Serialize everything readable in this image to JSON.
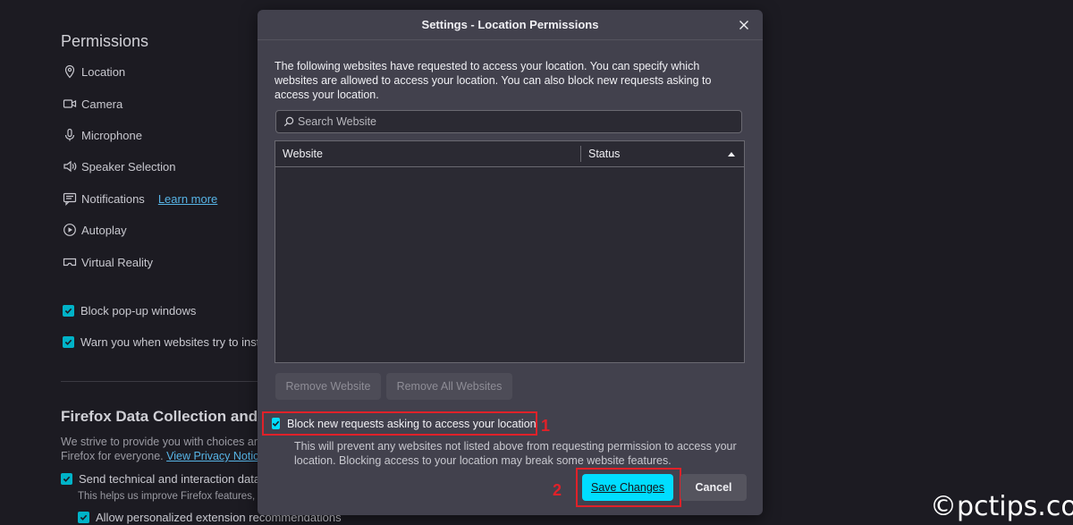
{
  "background": {
    "permissions_title": "Permissions",
    "permissions": [
      {
        "label": "Location",
        "icon": "location-pin-icon"
      },
      {
        "label": "Camera",
        "icon": "camera-icon"
      },
      {
        "label": "Microphone",
        "icon": "microphone-icon"
      },
      {
        "label": "Speaker Selection",
        "icon": "speaker-icon"
      },
      {
        "label": "Notifications",
        "icon": "notification-icon",
        "link": "Learn more"
      },
      {
        "label": "Autoplay",
        "icon": "autoplay-icon"
      },
      {
        "label": "Virtual Reality",
        "icon": "vr-icon"
      }
    ],
    "block_popups": "Block pop-up windows",
    "warn_addons": "Warn you when websites try to instal",
    "data_collection_title": "Firefox Data Collection and",
    "data_desc_1": "We strive to provide you with choices and",
    "data_desc_2_prefix": "Firefox for everyone. ",
    "privacy_link": "View Privacy Notice",
    "send_technical": "Send technical and interaction data to",
    "send_technical_note": "This helps us improve Firefox features, pe",
    "personalized_ext": "Allow personalized extension recommendations"
  },
  "dialog": {
    "title": "Settings - Location Permissions",
    "description": "The following websites have requested to access your location. You can specify which websites are allowed to access your location. You can also block new requests asking to access your location.",
    "search_placeholder": "Search Website",
    "columns": {
      "website": "Website",
      "status": "Status"
    },
    "rows": [],
    "remove_website": "Remove Website",
    "remove_all": "Remove All Websites",
    "block_label": "Block new requests asking to access your location",
    "block_checked": true,
    "note": "This will prevent any websites not listed above from requesting permission to access your location. Blocking access to your location may break some website features.",
    "save": "Save Changes",
    "cancel": "Cancel"
  },
  "annotations": {
    "marker_1": "1",
    "marker_2": "2"
  },
  "watermark": "©pctips.com",
  "colors": {
    "accent": "#00ddff",
    "highlight": "#e02129",
    "dialog_bg": "#42414d",
    "page_bg": "#1c1b22"
  }
}
